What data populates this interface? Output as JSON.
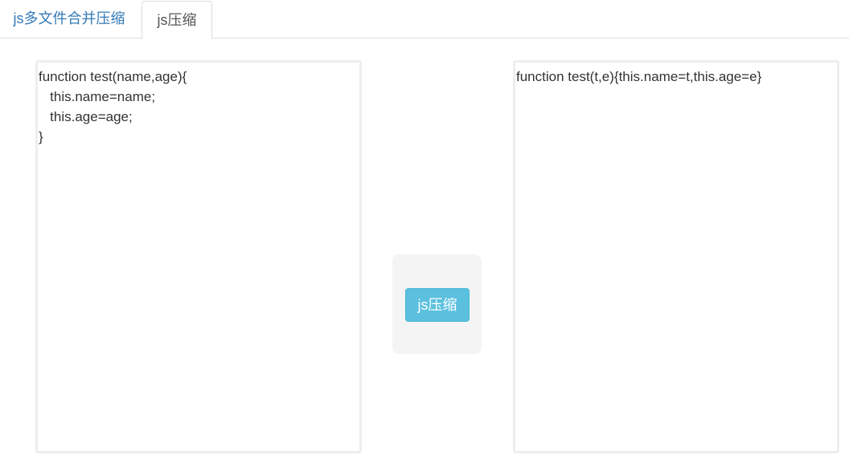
{
  "tabs": [
    {
      "label": "js多文件合并压缩",
      "active": false
    },
    {
      "label": "js压缩",
      "active": true
    }
  ],
  "input_editor": {
    "value": "function test(name,age){\n   this.name=name;\n   this.age=age;\n}"
  },
  "action": {
    "button_label": "js压缩"
  },
  "output_editor": {
    "value": "function test(t,e){this.name=t,this.age=e}"
  },
  "colors": {
    "tab_link": "#337ab7",
    "button_bg": "#5bc0de",
    "panel_bg": "#f4f4f4",
    "box_border": "#eeeeee"
  }
}
